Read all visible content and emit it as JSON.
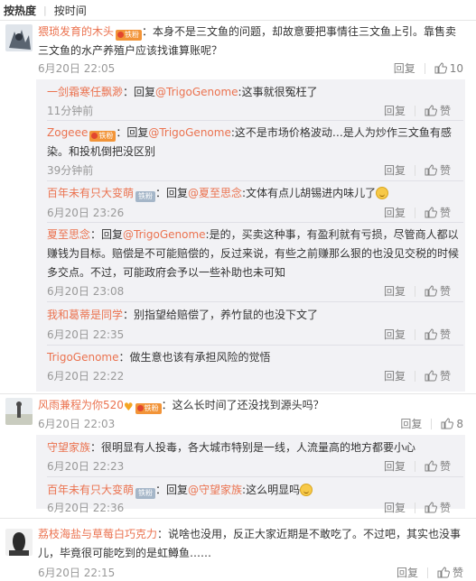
{
  "sort_tabs": [
    "按热度",
    "按时间"
  ],
  "actions": {
    "reply": "回复",
    "like": "赞"
  },
  "badges": {
    "fan": "铁粉",
    "iron": "铁粉"
  },
  "comments": [
    {
      "user": "猥琐发育的木头",
      "text": "：本身不是三文鱼的问题，却故意要把事情往三文鱼上引。靠售卖三文鱼的水产养殖户应该找谁算账呢？",
      "time": "6月20日 22:05",
      "likes": "10",
      "replies": [
        {
          "user": "一剑霜寒任飘渺",
          "prefix": "：回复",
          "mention": "@TrigoGenome",
          "text": ":这事就很冤枉了",
          "time": "11分钟前",
          "like_label": "赞"
        },
        {
          "user": "Zogeee",
          "prefix": "：回复",
          "mention": "@TrigoGenome",
          "text": ":这不是市场价格波动…是人为炒作三文鱼有感染。和投机倒把没区别",
          "time": "39分钟前",
          "like_label": "赞"
        },
        {
          "user": "百年未有只大变萌",
          "prefix": "：回复",
          "mention": "@夏至思念",
          "text": ":文体有点儿胡锡进内味儿了",
          "time": "6月20日 23:26",
          "like_label": "赞"
        },
        {
          "user": "夏至思念",
          "prefix": "：回复",
          "mention": "@TrigoGenome",
          "text": ":是的，买卖这种事，有盈利就有亏损，尽管商人都以赚钱为目标。赔偿是不可能赔偿的，反过来说，有些之前赚那么狠的也没见交税的时候多交点。不过，可能政府会予以一些补助也未可知",
          "time": "6月20日 23:08",
          "like_label": "赞"
        },
        {
          "user": "我和葛蒂是同学",
          "prefix": "",
          "mention": "",
          "text": "：别指望给赔偿了，养竹鼠的也没下文了",
          "time": "6月20日 22:35",
          "like_label": "赞"
        },
        {
          "user": "TrigoGenome",
          "prefix": "",
          "mention": "",
          "text": "：做生意也该有承担风险的觉悟",
          "time": "6月20日 22:22",
          "like_label": "赞"
        }
      ]
    },
    {
      "user": "风雨兼程为你520",
      "text": "：这么长时间了还没找到源头吗？",
      "time": "6月20日 22:03",
      "likes": "8",
      "replies": [
        {
          "user": "守望家族",
          "prefix": "",
          "mention": "",
          "text": "：很明显有人投毒，各大城市特别是一线，人流量高的地方都要小心",
          "time": "6月20日 22:23",
          "like_label": "赞"
        },
        {
          "user": "百年未有只大变萌",
          "prefix": "：回复",
          "mention": "@守望家族",
          "text": ":这么明显吗",
          "time": "6月20日 22:36",
          "like_label": "赞"
        }
      ]
    },
    {
      "user": "荔枝海盐与草莓白巧克力",
      "text": "：说啥也没用，反正大家近期是不敢吃了。不过吧，其实也没事儿，毕竟很可能吃到的是虹鳟鱼……",
      "time": "6月20日 22:15",
      "likes": "",
      "like_label": "赞"
    }
  ]
}
